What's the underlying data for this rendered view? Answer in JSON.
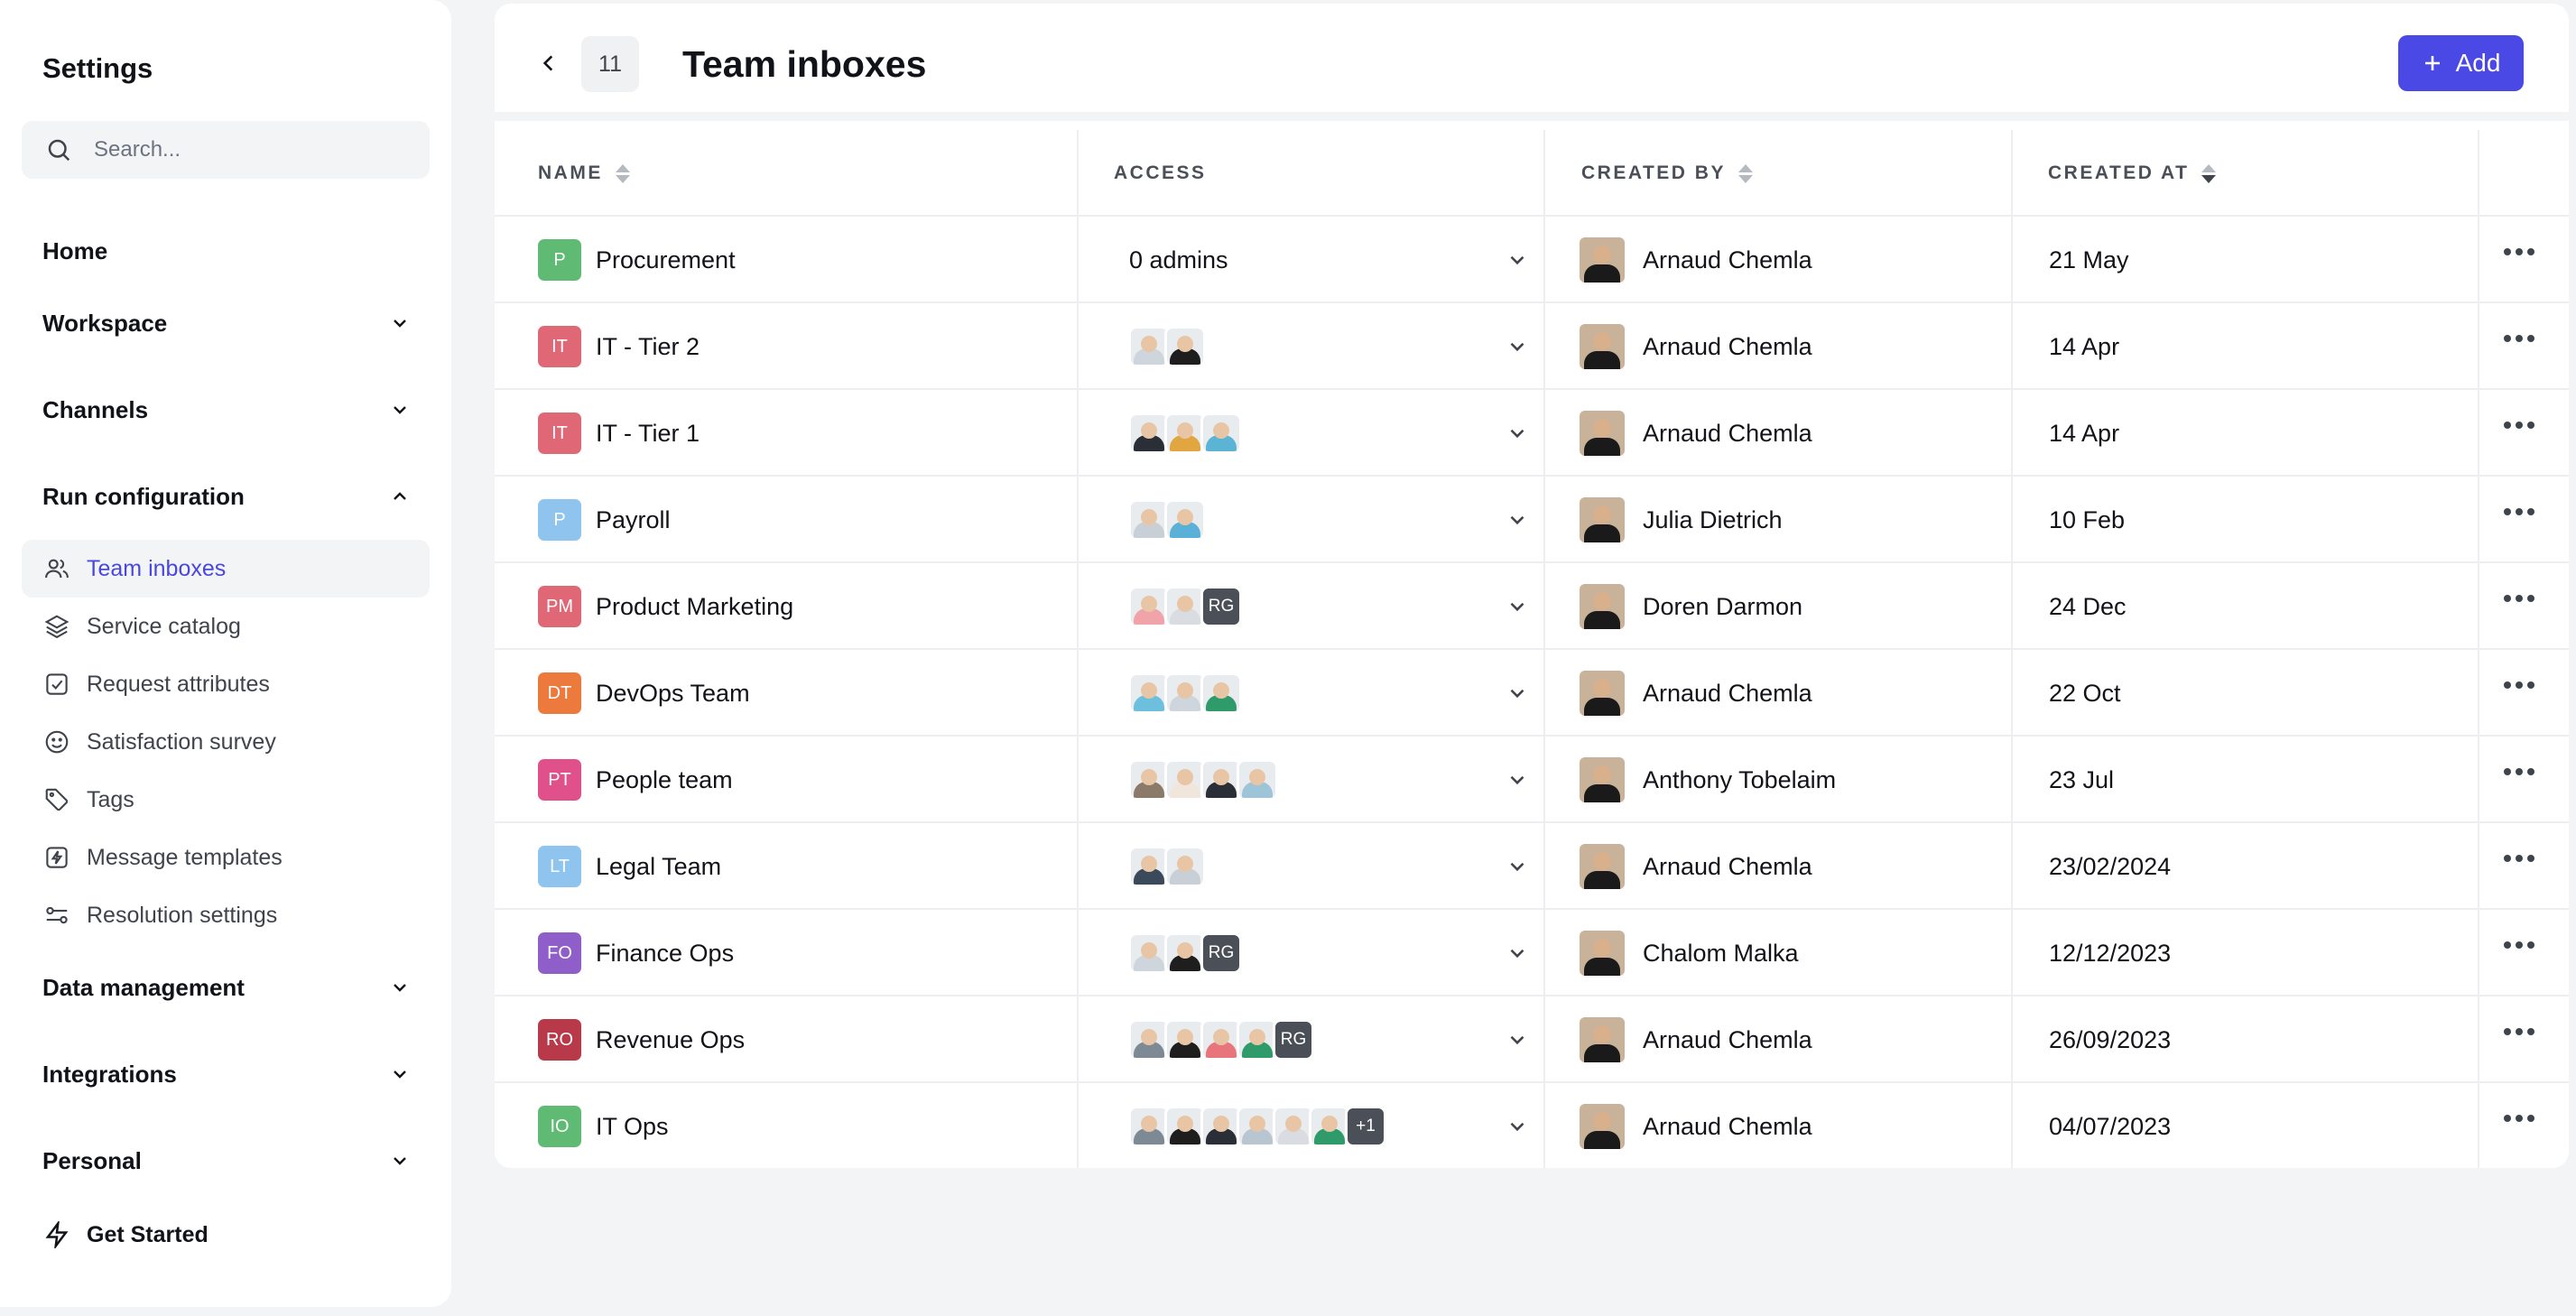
{
  "sidebar": {
    "title": "Settings",
    "search_placeholder": "Search...",
    "sections": [
      {
        "label": "Home"
      },
      {
        "label": "Workspace"
      },
      {
        "label": "Channels"
      },
      {
        "label": "Run configuration"
      },
      {
        "label": "Data management"
      },
      {
        "label": "Integrations"
      },
      {
        "label": "Personal"
      }
    ],
    "run_items": [
      {
        "label": "Team inboxes",
        "icon": "users-icon"
      },
      {
        "label": "Service catalog",
        "icon": "layers-icon"
      },
      {
        "label": "Request attributes",
        "icon": "checkbox-icon"
      },
      {
        "label": "Satisfaction survey",
        "icon": "smiley-icon"
      },
      {
        "label": "Tags",
        "icon": "tag-icon"
      },
      {
        "label": "Message templates",
        "icon": "bolt-square-icon"
      },
      {
        "label": "Resolution settings",
        "icon": "sliders-icon"
      }
    ],
    "get_started": "Get Started"
  },
  "header": {
    "count": "11",
    "title": "Team inboxes",
    "add_label": "Add"
  },
  "table": {
    "columns": {
      "name": "NAME",
      "access": "ACCESS",
      "created_by": "CREATED BY",
      "created_at": "CREATED AT"
    },
    "rows": [
      {
        "initials": "P",
        "badge_color": "#5fba74",
        "name": "Procurement",
        "access_text": "0 admins",
        "avatars": [],
        "creator": "Arnaud Chemla",
        "created_at": "21 May"
      },
      {
        "initials": "IT",
        "badge_color": "#e06876",
        "name": "IT - Tier 2",
        "access_text": "",
        "avatars": [
          "#cfd5dc",
          "#1e1e1e"
        ],
        "creator": "Arnaud Chemla",
        "created_at": "14 Apr"
      },
      {
        "initials": "IT",
        "badge_color": "#e06876",
        "name": "IT - Tier 1",
        "access_text": "",
        "avatars": [
          "#2a2e36",
          "#e2a640",
          "#5bb4d4"
        ],
        "creator": "Arnaud Chemla",
        "created_at": "14 Apr"
      },
      {
        "initials": "P",
        "badge_color": "#8ec4ee",
        "name": "Payroll",
        "access_text": "",
        "avatars": [
          "#c9cfd6",
          "#5ab0d6"
        ],
        "creator": "Julia Dietrich",
        "created_at": "10 Feb"
      },
      {
        "initials": "PM",
        "badge_color": "#e06876",
        "name": "Product Marketing",
        "access_text": "",
        "avatars": [
          "#f0a3a8",
          "#d9dde2",
          "RG"
        ],
        "creator": "Doren Darmon",
        "created_at": "24 Dec"
      },
      {
        "initials": "DT",
        "badge_color": "#ec7a3d",
        "name": "DevOps Team",
        "access_text": "",
        "avatars": [
          "#6cc0de",
          "#cfd5dc",
          "#2f9a6a"
        ],
        "creator": "Arnaud Chemla",
        "created_at": "22 Oct"
      },
      {
        "initials": "PT",
        "badge_color": "#e0508a",
        "name": "People team",
        "access_text": "",
        "avatars": [
          "#8b7a6a",
          "#f0e6dc",
          "#2a2e36",
          "#9ec4d8"
        ],
        "creator": "Anthony Tobelaim",
        "created_at": "23 Jul"
      },
      {
        "initials": "LT",
        "badge_color": "#8ec4ee",
        "name": "Legal Team",
        "access_text": "",
        "avatars": [
          "#3a4a5a",
          "#c9cfd6"
        ],
        "creator": "Arnaud Chemla",
        "created_at": "23/02/2024"
      },
      {
        "initials": "FO",
        "badge_color": "#8f5ec9",
        "name": "Finance Ops",
        "access_text": "",
        "avatars": [
          "#cfd5dc",
          "#1e1e1e",
          "RG"
        ],
        "creator": "Chalom Malka",
        "created_at": "12/12/2023"
      },
      {
        "initials": "RO",
        "badge_color": "#b83a4a",
        "name": "Revenue Ops",
        "access_text": "",
        "avatars": [
          "#7d8a96",
          "#1e1e1e",
          "#e8757c",
          "#2f9a6a",
          "RG"
        ],
        "creator": "Arnaud Chemla",
        "created_at": "26/09/2023"
      },
      {
        "initials": "IO",
        "badge_color": "#5fba74",
        "name": "IT Ops",
        "access_text": "",
        "avatars": [
          "#7d8a96",
          "#1e1e1e",
          "#2a2e36",
          "#b8c6d2",
          "#d9dde2",
          "#2f9a6a",
          "+1"
        ],
        "creator": "Arnaud Chemla",
        "created_at": "04/07/2023"
      }
    ]
  },
  "colors": {
    "accent": "#4b49e6",
    "active_text": "#4a47e0",
    "background": "#f3f4f6"
  }
}
